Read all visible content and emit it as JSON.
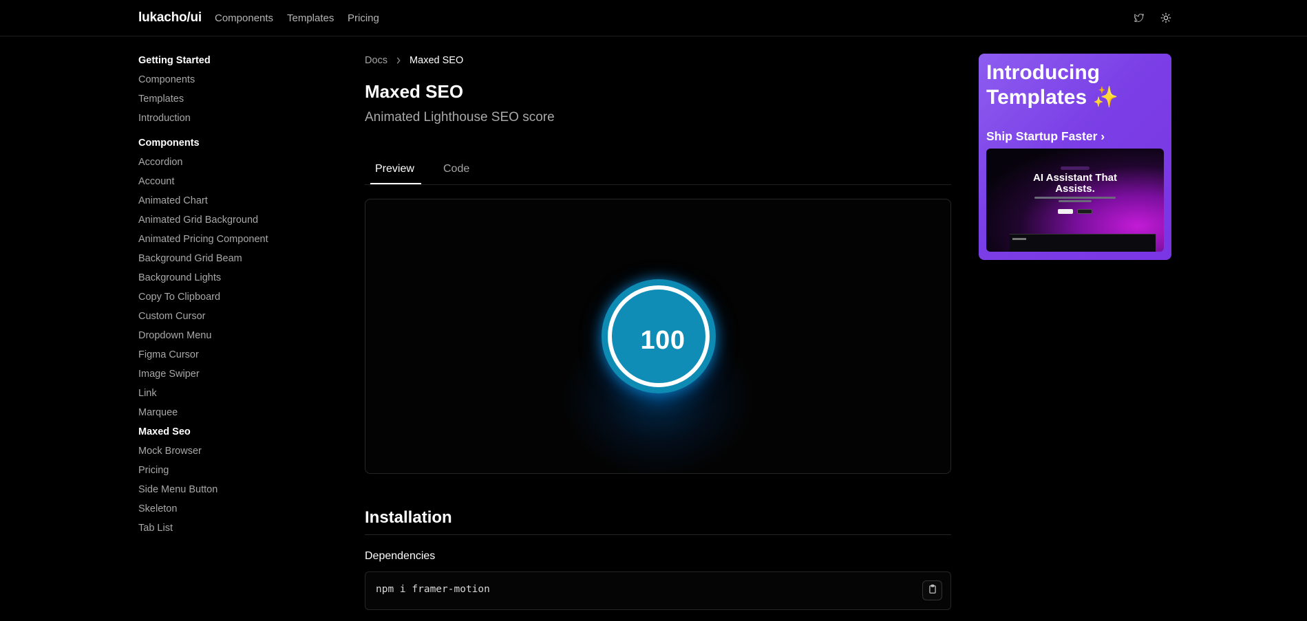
{
  "header": {
    "brand": "lukacho/ui",
    "nav": [
      "Components",
      "Templates",
      "Pricing"
    ],
    "icons": [
      "twitter-icon",
      "sun-icon"
    ]
  },
  "sidebar": {
    "getting_started": {
      "heading": "Getting Started",
      "items": [
        "Components",
        "Templates",
        "Introduction"
      ]
    },
    "components": {
      "heading": "Components",
      "items": [
        "Accordion",
        "Account",
        "Animated Chart",
        "Animated Grid Background",
        "Animated Pricing Component",
        "Background Grid Beam",
        "Background Lights",
        "Copy To Clipboard",
        "Custom Cursor",
        "Dropdown Menu",
        "Figma Cursor",
        "Image Swiper",
        "Link",
        "Marquee",
        "Maxed Seo",
        "Mock Browser",
        "Pricing",
        "Side Menu Button",
        "Skeleton",
        "Tab List"
      ],
      "active": "Maxed Seo"
    }
  },
  "breadcrumb": {
    "root": "Docs",
    "current": "Maxed SEO"
  },
  "page": {
    "title": "Maxed SEO",
    "subtitle": "Animated Lighthouse SEO score"
  },
  "tabs": {
    "preview": "Preview",
    "code": "Code",
    "active": "Preview"
  },
  "preview": {
    "score": "100"
  },
  "installation": {
    "title": "Installation",
    "dependencies_title": "Dependencies",
    "command": "npm i framer-motion"
  },
  "promo": {
    "title_line1": "Introducing",
    "title_line2": "Templates ✨",
    "link": "Ship Startup Faster ›",
    "screenshot_headline_1": "AI Assistant That",
    "screenshot_headline_2": "Assists."
  },
  "colors": {
    "background": "#000000",
    "score_fill": "#0e8bb3",
    "promo_purple": "#7b3fe6"
  }
}
